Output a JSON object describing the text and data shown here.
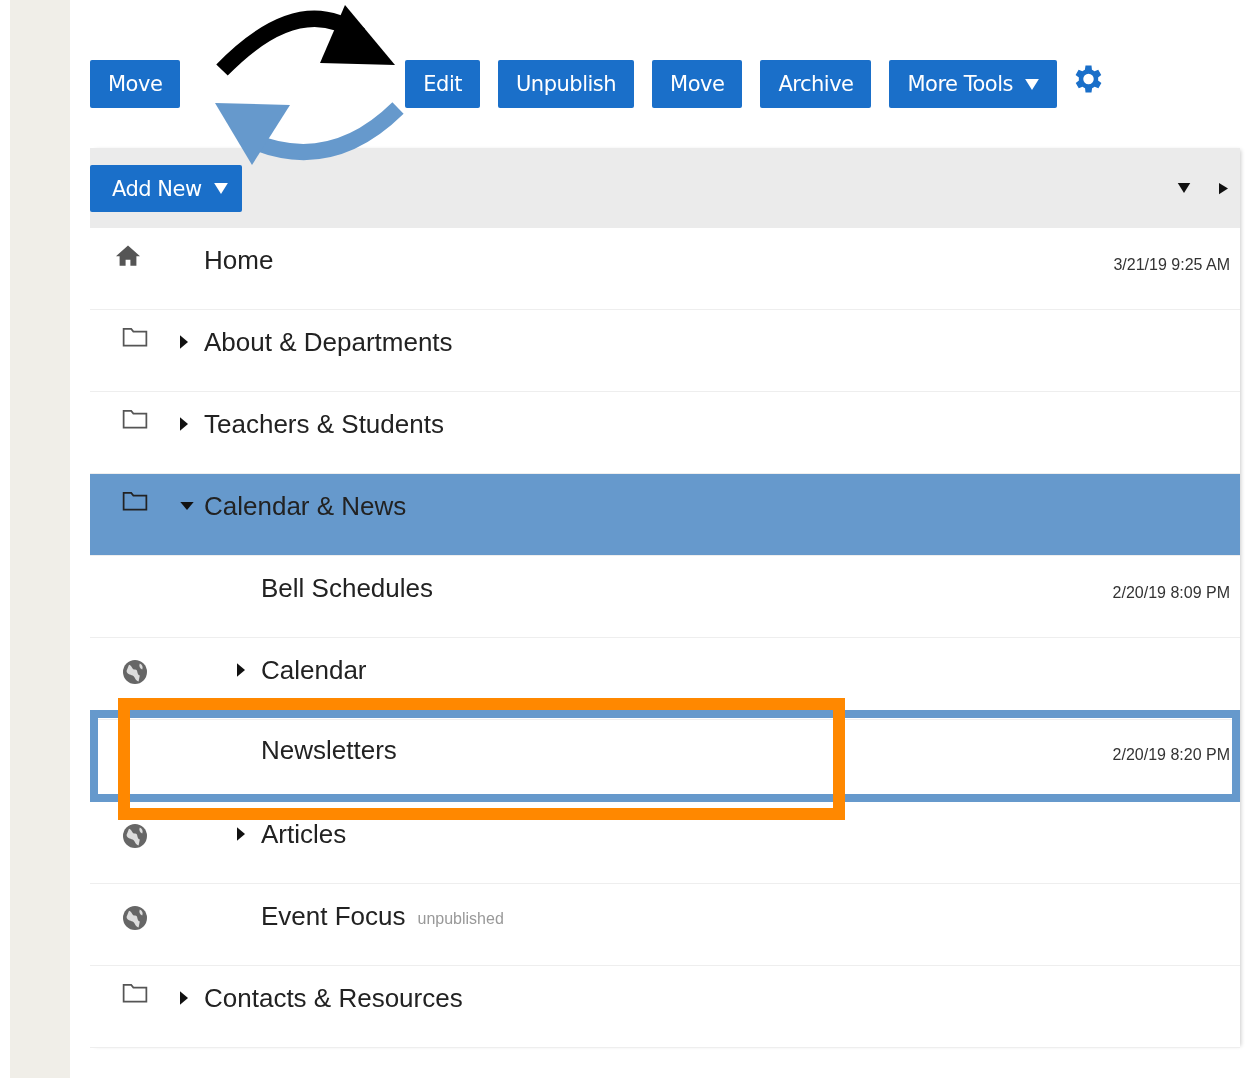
{
  "left_button": {
    "label": "Move"
  },
  "toolbar": {
    "buttons": [
      {
        "label": "Edit",
        "dropdown": false
      },
      {
        "label": "Unpublish",
        "dropdown": false
      },
      {
        "label": "Move",
        "dropdown": false
      },
      {
        "label": "Archive",
        "dropdown": false
      },
      {
        "label": "More Tools",
        "dropdown": true
      }
    ]
  },
  "add_new": {
    "label": "Add New",
    "dropdown": true
  },
  "tree": [
    {
      "label": "Home",
      "kind": "home",
      "expandable": false,
      "date": "3/21/19 9:25 AM",
      "selected": false,
      "drop_target": false
    },
    {
      "label": "About & Departments",
      "kind": "folder",
      "expandable": true,
      "expanded": false,
      "selected": false,
      "drop_target": false
    },
    {
      "label": "Teachers & Students",
      "kind": "folder",
      "expandable": true,
      "expanded": false,
      "selected": false,
      "drop_target": false
    },
    {
      "label": "Calendar & News",
      "kind": "folder",
      "expandable": true,
      "expanded": true,
      "selected": true,
      "drop_target": false,
      "children": [
        {
          "label": "Bell Schedules",
          "kind": "link",
          "expandable": false,
          "date": "2/20/19 8:09 PM",
          "selected": false,
          "drop_target": false
        },
        {
          "label": "Calendar",
          "kind": "public",
          "expandable": true,
          "expanded": false,
          "selected": false,
          "drop_target": false
        },
        {
          "label": "Newsletters",
          "kind": "link",
          "expandable": false,
          "date": "2/20/19 8:20 PM",
          "selected": false,
          "drop_target": true
        },
        {
          "label": "Articles",
          "kind": "public",
          "expandable": true,
          "expanded": false,
          "selected": false,
          "drop_target": false
        },
        {
          "label": "Event Focus",
          "kind": "public",
          "expandable": false,
          "badge": "unpublished",
          "selected": false,
          "drop_target": false
        }
      ]
    },
    {
      "label": "Contacts & Resources",
      "kind": "folder",
      "expandable": true,
      "expanded": false,
      "selected": false,
      "drop_target": false
    }
  ]
}
